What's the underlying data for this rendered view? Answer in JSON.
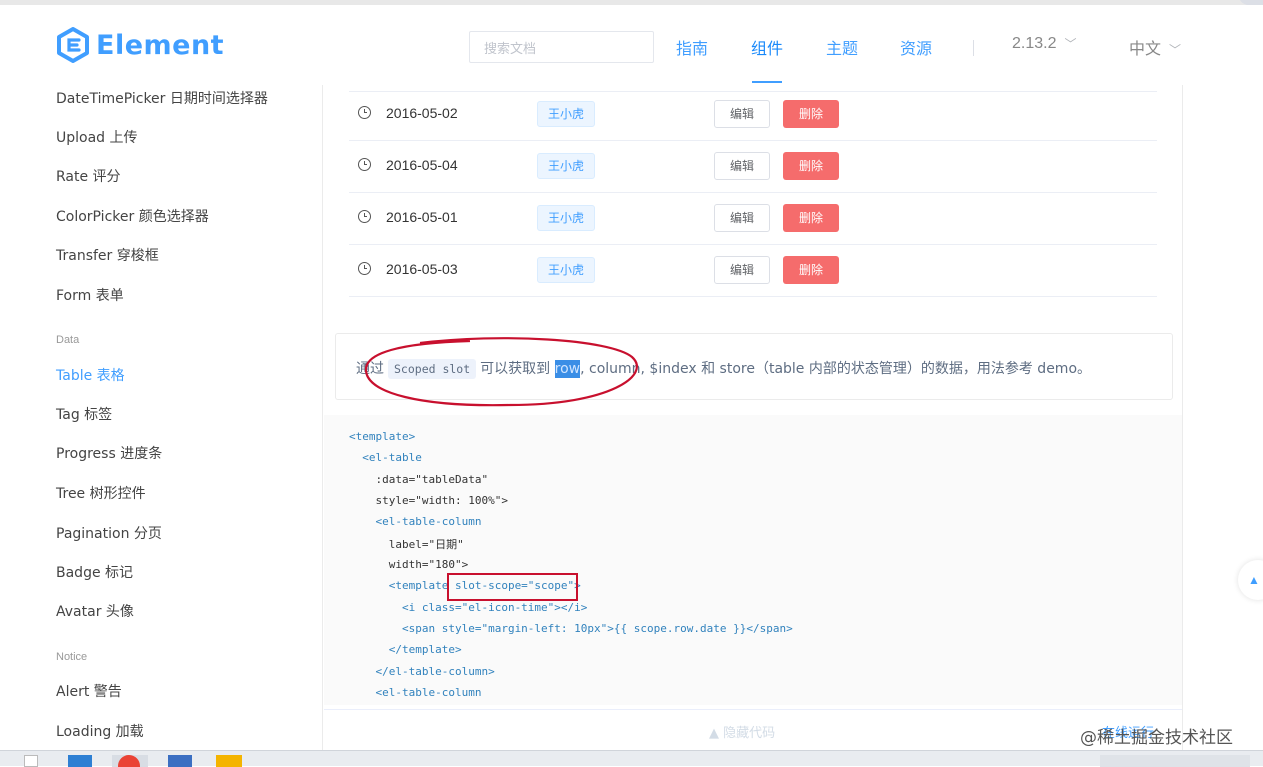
{
  "header": {
    "logo_text": "Element",
    "search_placeholder": "搜索文档",
    "nav": [
      "指南",
      "组件",
      "主题",
      "资源"
    ],
    "active_nav": "组件",
    "version": "2.13.2",
    "language": "中文",
    "brand_color": "#409eff"
  },
  "sidebar": {
    "items_top": [
      "DateTimePicker 日期时间选择器",
      "Upload 上传",
      "Rate 评分",
      "ColorPicker 颜色选择器",
      "Transfer 穿梭框",
      "Form 表单"
    ],
    "group_data": "Data",
    "items_data": [
      "Table 表格",
      "Tag 标签",
      "Progress 进度条",
      "Tree 树形控件",
      "Pagination 分页",
      "Badge 标记",
      "Avatar 头像"
    ],
    "group_notice": "Notice",
    "items_notice": [
      "Alert 警告",
      "Loading 加载"
    ],
    "active_item": "Table 表格"
  },
  "table": {
    "rows": [
      {
        "date": "2016-05-02",
        "name": "王小虎",
        "edit": "编辑",
        "delete": "删除"
      },
      {
        "date": "2016-05-04",
        "name": "王小虎",
        "edit": "编辑",
        "delete": "删除"
      },
      {
        "date": "2016-05-01",
        "name": "王小虎",
        "edit": "编辑",
        "delete": "删除"
      },
      {
        "date": "2016-05-03",
        "name": "王小虎",
        "edit": "编辑",
        "delete": "删除"
      }
    ],
    "delete_color": "#f56c6c"
  },
  "description": {
    "prefix": "通过",
    "code": "Scoped slot",
    "middle": "可以获取到",
    "selected": "row",
    "suffix": ", column, $index 和 store（table 内部的状态管理）的数据，用法参考 demo。"
  },
  "code_lines": [
    "<template>",
    "  <el-table",
    "    :data=\"tableData\"",
    "    style=\"width: 100%\">",
    "    <el-table-column",
    "      label=\"日期\"",
    "      width=\"180\">",
    "      <template slot-scope=\"scope\">",
    "        <i class=\"el-icon-time\"></i>",
    "        <span style=\"margin-left: 10px\">{{ scope.row.date }}</span>",
    "      </template>",
    "    </el-table-column>",
    "    <el-table-column"
  ],
  "controls": {
    "hide_code": "隐藏代码",
    "right_link": "在线运行"
  },
  "watermark": "@稀土掘金技术社区",
  "annotation_color": "#c8102e"
}
